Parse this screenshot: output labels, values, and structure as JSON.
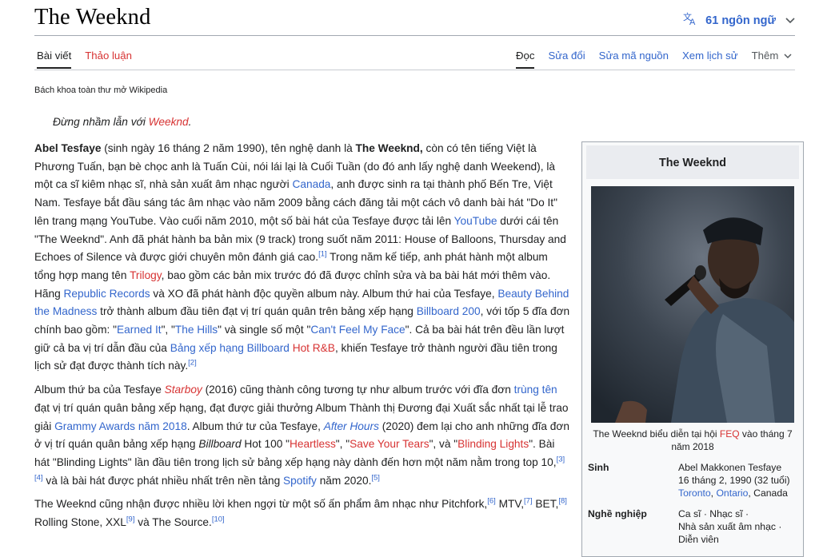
{
  "title": "The Weeknd",
  "languages": {
    "label": "61 ngôn ngữ",
    "icon": "translate-icon"
  },
  "tabs_left": [
    "Bài viết",
    "Thảo luận"
  ],
  "tabs_right": [
    "Đọc",
    "Sửa đổi",
    "Sửa mã nguồn",
    "Xem lịch sử",
    "Thêm"
  ],
  "tagline": "Bách khoa toàn thư mở Wikipedia",
  "hatnote": {
    "prefix": "Đừng nhầm lẫn với ",
    "link": "Weeknd",
    "suffix": "."
  },
  "colors": {
    "link": "#3366cc",
    "redlink": "#d73333",
    "infobox_bg": "#f8f9fa"
  },
  "article": {
    "p1": [
      {
        "t": "Abel Tesfaye",
        "s": "b"
      },
      {
        "t": " (sinh ngày 16 tháng 2 năm 1990), tên nghệ danh là "
      },
      {
        "t": "The Weeknd,",
        "s": "b"
      },
      {
        "t": " còn có tên tiếng Việt là Phương Tuấn, bạn bè chọc anh là Tuấn Cùi, nói lái lại là Cuối Tuần (do đó anh lấy nghệ danh Weekend), là một ca sĩ kiêm nhạc sĩ, nhà sản xuất âm nhạc người "
      },
      {
        "t": "Canada",
        "s": "link"
      },
      {
        "t": ", anh được sinh ra tại thành phố Bến Tre, Việt Nam. Tesfaye bắt đầu sáng tác âm nhạc vào năm 2009 bằng cách đăng tải một cách vô danh bài hát \"Do It\" lên trang mạng YouTube. Vào cuối năm 2010, một số bài hát của Tesfaye được tải lên "
      },
      {
        "t": "YouTube",
        "s": "link"
      },
      {
        "t": " dưới cái tên \"The Weeknd\". Anh đã phát hành ba bản mix (9 track) trong suốt năm 2011: House of Balloons, Thursday and Echoes of Silence và được giới chuyên môn đánh giá cao."
      },
      {
        "t": "[1]",
        "s": "ref"
      },
      {
        "t": " Trong năm kế tiếp, anh phát hành một album tổng hợp mang tên "
      },
      {
        "t": "Trilogy",
        "s": "red"
      },
      {
        "t": ", bao gồm các bản mix trước đó đã được chỉnh sửa và ba bài hát mới thêm vào. Hãng "
      },
      {
        "t": "Republic Records",
        "s": "link"
      },
      {
        "t": " và XO đã phát hành độc quyền album này. Album thứ hai của Tesfaye, "
      },
      {
        "t": "Beauty Behind the Madness",
        "s": "link"
      },
      {
        "t": " trở thành album đầu tiên đạt vị trí quán quân trên bảng xếp hạng "
      },
      {
        "t": "Billboard 200",
        "s": "link"
      },
      {
        "t": ", với tốp 5 đĩa đơn chính bao gồm: \""
      },
      {
        "t": "Earned It",
        "s": "link"
      },
      {
        "t": "\", \""
      },
      {
        "t": "The Hills",
        "s": "link"
      },
      {
        "t": "\" và single số một \""
      },
      {
        "t": "Can't Feel My Face",
        "s": "link"
      },
      {
        "t": "\". Cả ba bài hát trên đều lần lượt giữ cả ba vị trí dẫn đầu của "
      },
      {
        "t": "Bảng xếp hạng Billboard",
        "s": "link"
      },
      {
        "t": " "
      },
      {
        "t": "Hot R&B",
        "s": "red"
      },
      {
        "t": ", khiến Tesfaye trở thành người đầu tiên trong lịch sử đạt được thành tích này."
      },
      {
        "t": "[2]",
        "s": "ref"
      }
    ],
    "p2": [
      {
        "t": "Album thứ ba của Tesfaye "
      },
      {
        "t": "Starboy",
        "s": "red-i"
      },
      {
        "t": " (2016) cũng thành công tương tự như album trước với đĩa đơn "
      },
      {
        "t": "trùng tên",
        "s": "link"
      },
      {
        "t": " đạt vị trí quán quân bảng xếp hạng, đạt được giải thưởng Album Thành thị Đương đại Xuất sắc nhất tại lễ trao giải "
      },
      {
        "t": "Grammy Awards năm 2018",
        "s": "link"
      },
      {
        "t": ". Album thứ tư của Tesfaye, "
      },
      {
        "t": "After Hours",
        "s": "link-i"
      },
      {
        "t": " (2020) đem lại cho anh những đĩa đơn ở vị trí quán quân bảng xếp hạng "
      },
      {
        "t": "Billboard",
        "s": "i"
      },
      {
        "t": " Hot 100 \""
      },
      {
        "t": "Heartless",
        "s": "red"
      },
      {
        "t": "\", \""
      },
      {
        "t": "Save Your Tears",
        "s": "red"
      },
      {
        "t": "\", và \""
      },
      {
        "t": "Blinding Lights",
        "s": "red"
      },
      {
        "t": "\". Bài hát \"Blinding Lights\" lần đầu tiên trong lịch sử bảng xếp hạng này dành đến hơn một năm nằm trong top 10,"
      },
      {
        "t": "[3]",
        "s": "ref"
      },
      {
        "t": "[4]",
        "s": "ref"
      },
      {
        "t": " và là bài hát được phát nhiều nhất trên nền tảng "
      },
      {
        "t": "Spotify",
        "s": "link"
      },
      {
        "t": " năm 2020."
      },
      {
        "t": "[5]",
        "s": "ref"
      }
    ],
    "p3": [
      {
        "t": "The Weeknd cũng nhận được nhiều lời khen ngợi từ một số ấn phẩm âm nhạc như Pitchfork,"
      },
      {
        "t": "[6]",
        "s": "ref"
      },
      {
        "t": " MTV,"
      },
      {
        "t": "[7]",
        "s": "ref"
      },
      {
        "t": " BET,"
      },
      {
        "t": "[8]",
        "s": "ref"
      },
      {
        "t": " Rolling Stone, XXL"
      },
      {
        "t": "[9]",
        "s": "ref"
      },
      {
        "t": " và The Source."
      },
      {
        "t": "[10]",
        "s": "ref"
      }
    ]
  },
  "infobox": {
    "title": "The Weeknd",
    "caption": [
      {
        "t": "The Weeknd biểu diễn tại hội "
      },
      {
        "t": "FEQ",
        "s": "red"
      },
      {
        "t": " vào tháng 7 năm 2018"
      }
    ],
    "rows": [
      {
        "label": "Sinh",
        "value": [
          {
            "t": "Abel Makkonen Tesfaye"
          },
          {
            "t": "16 tháng 2, 1990 (32 tuổi)",
            "s": "br-before"
          },
          {
            "t": "Toronto",
            "s": "link-br"
          },
          {
            "t": ", "
          },
          {
            "t": "Ontario",
            "s": "link"
          },
          {
            "t": ", Canada"
          }
        ]
      },
      {
        "label": "Nghề nghiệp",
        "value": [
          {
            "t": "Ca sĩ · Nhạc sĩ ·"
          },
          {
            "t": "Nhà sản xuất âm nhạc ·",
            "s": "br-before"
          },
          {
            "t": "Diễn viên",
            "s": "br-before"
          }
        ]
      }
    ]
  }
}
